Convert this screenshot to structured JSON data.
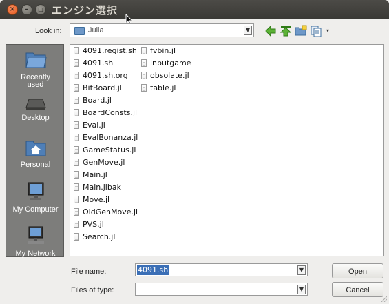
{
  "window": {
    "title": "エンジン選択"
  },
  "look_in": {
    "label": "Look in:",
    "value": "Julia"
  },
  "sidebar": {
    "items": [
      {
        "label": "Recently used",
        "icon": "recent-folder-icon"
      },
      {
        "label": "Desktop",
        "icon": "desktop-icon"
      },
      {
        "label": "Personal",
        "icon": "home-folder-icon"
      },
      {
        "label": "My Computer",
        "icon": "computer-icon"
      },
      {
        "label": "My Network",
        "icon": "network-icon"
      }
    ]
  },
  "files": {
    "column1": [
      "4091.regist.sh",
      "4091.sh",
      "4091.sh.org",
      "BitBoard.jl",
      "Board.jl",
      "BoardConsts.jl",
      "Eval.jl",
      "EvalBonanza.jl",
      "GameStatus.jl",
      "GenMove.jl",
      "Main.jl",
      "Main.jlbak",
      "Move.jl",
      "OldGenMove.jl",
      "PVS.jl",
      "Search.jl"
    ],
    "column2": [
      "fvbin.jl",
      "inputgame",
      "obsolate.jl",
      "table.jl"
    ]
  },
  "file_name": {
    "label": "File name:",
    "value": "4091.sh"
  },
  "files_of_type": {
    "label": "Files of type:",
    "value": ""
  },
  "buttons": {
    "open": "Open",
    "cancel": "Cancel"
  },
  "colors": {
    "accent": "#3b6fb6",
    "sidebar": "#7d7d7b",
    "titlebar": "#3c3b37"
  }
}
